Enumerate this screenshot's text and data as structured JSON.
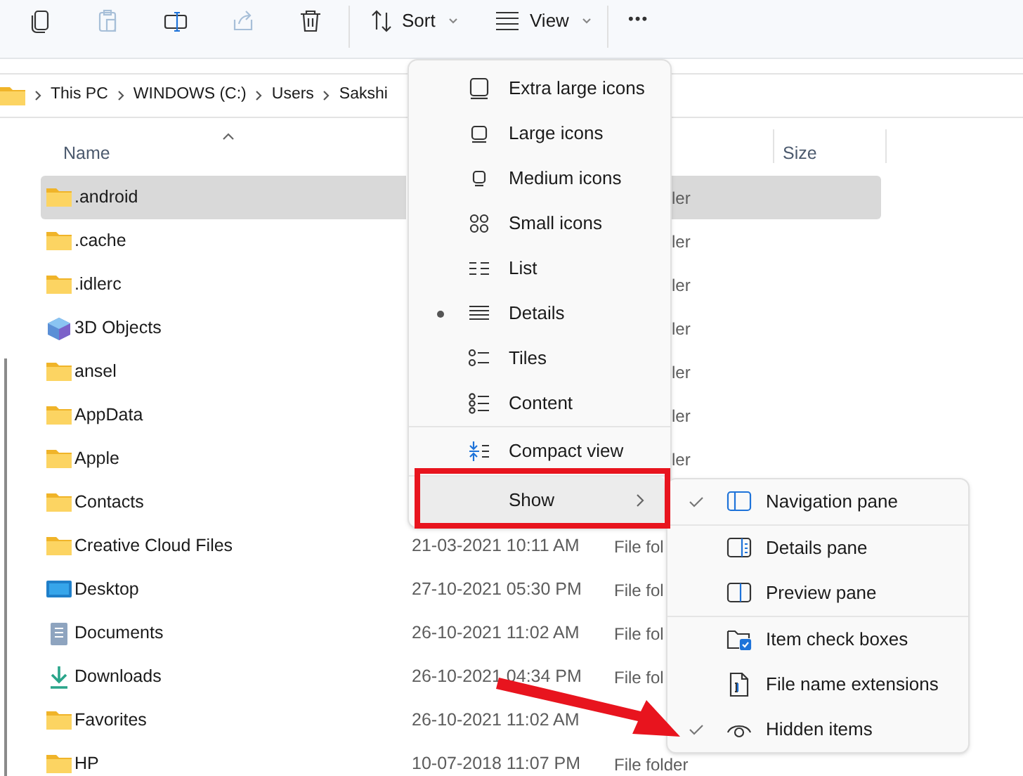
{
  "toolbar": {
    "sort": {
      "label": "Sort"
    },
    "view": {
      "label": "View"
    },
    "more": {
      "label": "•••"
    }
  },
  "breadcrumb": [
    "This PC",
    "WINDOWS (C:)",
    "Users",
    "Sakshi"
  ],
  "columns": [
    {
      "label": "Name"
    },
    {
      "label": "Size"
    }
  ],
  "rows": [
    {
      "name": ".android",
      "kind": "folder",
      "type": "ler",
      "selected": true
    },
    {
      "name": ".cache",
      "kind": "folder",
      "type": "ler",
      "selected": false
    },
    {
      "name": ".idlerc",
      "kind": "folder",
      "type": "ler",
      "selected": false
    },
    {
      "name": "3D Objects",
      "kind": "objects",
      "type": "ler",
      "selected": false
    },
    {
      "name": "ansel",
      "kind": "folder",
      "type": "ler",
      "selected": false
    },
    {
      "name": "AppData",
      "kind": "folder",
      "type": "ler",
      "selected": false
    },
    {
      "name": "Apple",
      "kind": "folder",
      "type": "ler",
      "selected": false
    },
    {
      "name": "Contacts",
      "kind": "folder",
      "selected": false
    },
    {
      "name": "Creative Cloud Files",
      "kind": "folder",
      "date": "21-03-2021 10:11 AM",
      "type": "File fol",
      "selected": false
    },
    {
      "name": "Desktop",
      "kind": "desktop",
      "date": "27-10-2021 05:30 PM",
      "type": "File fol",
      "selected": false
    },
    {
      "name": "Documents",
      "kind": "documents",
      "date": "26-10-2021 11:02 AM",
      "type": "File fol",
      "selected": false
    },
    {
      "name": "Downloads",
      "kind": "downloads",
      "date": "26-10-2021 04:34 PM",
      "type": "File fol",
      "selected": false
    },
    {
      "name": "Favorites",
      "kind": "folder",
      "date": "26-10-2021 11:02 AM",
      "selected": false
    },
    {
      "name": "HP",
      "kind": "folder",
      "date": "10-07-2018 11:07 PM",
      "type": "File folder",
      "selected": false
    }
  ],
  "view_menu": {
    "groups": [
      [
        {
          "label": "Extra large icons",
          "selected": false
        },
        {
          "label": "Large icons",
          "selected": false
        },
        {
          "label": "Medium icons",
          "selected": false
        },
        {
          "label": "Small icons",
          "selected": false
        },
        {
          "label": "List",
          "selected": false
        },
        {
          "label": "Details",
          "selected": true
        },
        {
          "label": "Tiles",
          "selected": false
        },
        {
          "label": "Content",
          "selected": false
        }
      ],
      [
        {
          "label": "Compact view",
          "selected": false
        }
      ],
      [
        {
          "label": "Show",
          "kind": "submenu",
          "highlighted": true
        }
      ]
    ]
  },
  "show_menu": {
    "groups": [
      [
        {
          "label": "Navigation pane",
          "checked": true
        }
      ],
      [
        {
          "label": "Details pane",
          "checked": false
        },
        {
          "label": "Preview pane",
          "checked": false
        }
      ],
      [
        {
          "label": "Item check boxes",
          "checked": false
        },
        {
          "label": "File name extensions",
          "checked": false
        },
        {
          "label": "Hidden items",
          "checked": true
        }
      ]
    ]
  }
}
